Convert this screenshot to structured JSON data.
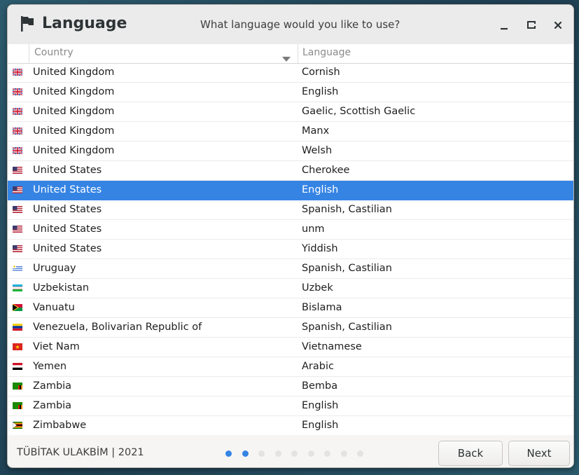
{
  "window": {
    "title": "Language",
    "subtitle": "What language would you like to use?",
    "icons": {
      "app": "flag-icon",
      "minimize": "minimize-icon",
      "maximize": "maximize-icon",
      "close": "close-icon"
    }
  },
  "table": {
    "headers": {
      "country": "Country",
      "language": "Language"
    },
    "selected_index": 6,
    "rows": [
      {
        "country": "United Kingdom",
        "language": "Cornish",
        "flag": "uk"
      },
      {
        "country": "United Kingdom",
        "language": "English",
        "flag": "uk"
      },
      {
        "country": "United Kingdom",
        "language": "Gaelic, Scottish Gaelic",
        "flag": "uk"
      },
      {
        "country": "United Kingdom",
        "language": "Manx",
        "flag": "uk"
      },
      {
        "country": "United Kingdom",
        "language": "Welsh",
        "flag": "uk"
      },
      {
        "country": "United States",
        "language": "Cherokee",
        "flag": "us"
      },
      {
        "country": "United States",
        "language": "English",
        "flag": "us"
      },
      {
        "country": "United States",
        "language": "Spanish, Castilian",
        "flag": "us"
      },
      {
        "country": "United States",
        "language": "unm",
        "flag": "us"
      },
      {
        "country": "United States",
        "language": "Yiddish",
        "flag": "us"
      },
      {
        "country": "Uruguay",
        "language": "Spanish, Castilian",
        "flag": "uy"
      },
      {
        "country": "Uzbekistan",
        "language": "Uzbek",
        "flag": "uz"
      },
      {
        "country": "Vanuatu",
        "language": "Bislama",
        "flag": "vu"
      },
      {
        "country": "Venezuela, Bolivarian Republic of",
        "language": "Spanish, Castilian",
        "flag": "ve"
      },
      {
        "country": "Viet Nam",
        "language": "Vietnamese",
        "flag": "vn"
      },
      {
        "country": "Yemen",
        "language": "Arabic",
        "flag": "ye"
      },
      {
        "country": "Zambia",
        "language": "Bemba",
        "flag": "zm"
      },
      {
        "country": "Zambia",
        "language": "English",
        "flag": "zm"
      },
      {
        "country": "Zimbabwe",
        "language": "English",
        "flag": "zw"
      }
    ]
  },
  "footer": {
    "credit": "TÜBİTAK ULAKBİM | 2021",
    "steps_total": 9,
    "steps_active": 2,
    "back_label": "Back",
    "next_label": "Next"
  },
  "colors": {
    "accent": "#3584e4"
  }
}
